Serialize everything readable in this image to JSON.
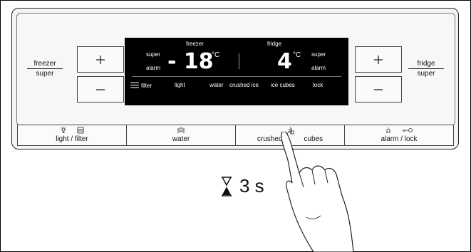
{
  "panel": {
    "freezer_super": {
      "top": "freezer",
      "bottom": "super"
    },
    "fridge_super": {
      "top": "fridge",
      "bottom": "super"
    },
    "plus_icon": "plus-icon",
    "minus_icon": "minus-icon"
  },
  "display": {
    "freezer_heading": "freezer",
    "fridge_heading": "fridge",
    "freezer_super": "super",
    "freezer_alarm": "alarm",
    "fridge_super": "super",
    "fridge_alarm": "alarm",
    "freezer_temp": "- 18",
    "fridge_temp": "4",
    "unit": "°C",
    "bottom_labels": [
      "filter",
      "light",
      "water",
      "crushed ice",
      "ice cubes",
      "lock"
    ]
  },
  "keys": [
    {
      "label": "light / filter",
      "icons": [
        "light-icon",
        "filter-icon"
      ]
    },
    {
      "label": "water",
      "icons": [
        "water-icon"
      ]
    },
    {
      "label": "crushed ice / cubes",
      "label_left": "crushed",
      "label_right": "cubes",
      "icons": [
        "ice-icon"
      ]
    },
    {
      "label": "alarm / lock",
      "icons": [
        "alarm-icon",
        "key-icon"
      ]
    }
  ],
  "instruction": {
    "duration": "3 s",
    "icon": "hourglass-icon"
  }
}
